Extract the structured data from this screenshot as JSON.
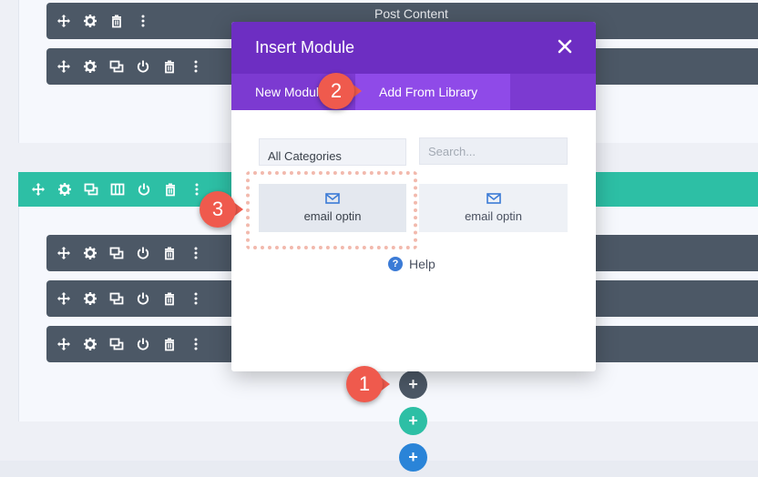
{
  "builder": {
    "top_bar_title": "Post Content",
    "icon_sets": {
      "module_short": [
        "move-icon",
        "gear-icon",
        "trash-icon",
        "more-icon"
      ],
      "module_full": [
        "move-icon",
        "gear-icon",
        "duplicate-icon",
        "power-icon",
        "trash-icon",
        "more-icon"
      ],
      "row": [
        "move-icon",
        "gear-icon",
        "duplicate-icon",
        "columns-icon",
        "power-icon",
        "trash-icon",
        "more-icon"
      ]
    },
    "colors": {
      "module_bar": "#4c5866",
      "row_bar": "#2dbfa5",
      "section_add": "#2a84d8"
    }
  },
  "modal": {
    "title": "Insert Module",
    "close_icon": "close-icon",
    "tabs": [
      {
        "label": "New Module",
        "active": false
      },
      {
        "label": "Add From Library",
        "active": true
      }
    ],
    "category_select": {
      "selected": "All Categories"
    },
    "search": {
      "value": "",
      "placeholder": "Search..."
    },
    "items": [
      {
        "label": "email optin",
        "icon": "envelope-icon"
      },
      {
        "label": "email optin",
        "icon": "envelope-icon"
      }
    ],
    "help_label": "Help",
    "colors": {
      "header": "#6d2ec2",
      "tabs": "#7c3ad1",
      "active_tab": "#8f4ae8"
    }
  },
  "add_buttons": [
    {
      "glyph": "+",
      "kind": "module"
    },
    {
      "glyph": "+",
      "kind": "row"
    },
    {
      "glyph": "+",
      "kind": "section"
    }
  ],
  "callouts": [
    {
      "number": "1"
    },
    {
      "number": "2"
    },
    {
      "number": "3"
    }
  ],
  "callout_color": "#ef5a4d"
}
